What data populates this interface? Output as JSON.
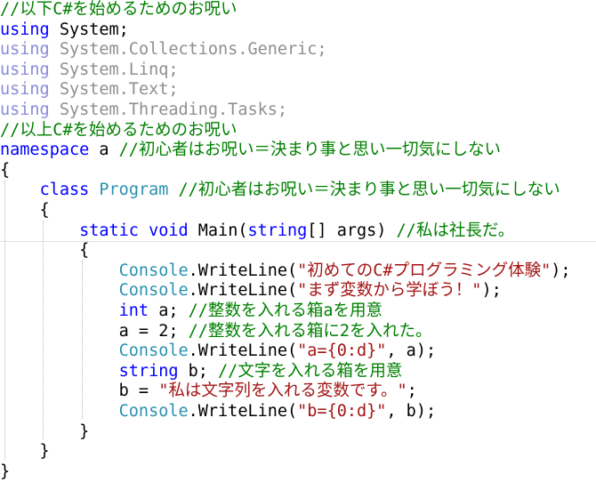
{
  "editor": {
    "lines": [
      {
        "tokens": [
          {
            "t": "//以下C#を始めるためのお呪い",
            "c": "cm"
          }
        ]
      },
      {
        "tokens": [
          {
            "t": "using",
            "c": "kw"
          },
          {
            "t": " System;",
            "c": "plain"
          }
        ]
      },
      {
        "tokens": [
          {
            "t": "using",
            "c": "kw-dim"
          },
          {
            "t": " System.Collections.Generic;",
            "c": "dim"
          }
        ]
      },
      {
        "tokens": [
          {
            "t": "using",
            "c": "kw-dim"
          },
          {
            "t": " System.Linq;",
            "c": "dim"
          }
        ]
      },
      {
        "tokens": [
          {
            "t": "using",
            "c": "kw-dim"
          },
          {
            "t": " System.Text;",
            "c": "dim"
          }
        ]
      },
      {
        "tokens": [
          {
            "t": "using",
            "c": "kw-dim"
          },
          {
            "t": " System.Threading.Tasks;",
            "c": "dim"
          }
        ]
      },
      {
        "tokens": [
          {
            "t": "//以上C#を始めるためのお呪い",
            "c": "cm"
          }
        ]
      },
      {
        "tokens": [
          {
            "t": "namespace",
            "c": "kw"
          },
          {
            "t": " a ",
            "c": "plain"
          },
          {
            "t": "//初心者はお呪い＝決まり事と思い一切気にしない",
            "c": "cm"
          }
        ]
      },
      {
        "tokens": [
          {
            "t": "{",
            "c": "plain"
          }
        ]
      },
      {
        "tokens": [
          {
            "t": "    ",
            "c": "plain"
          },
          {
            "t": "class",
            "c": "kw"
          },
          {
            "t": " ",
            "c": "plain"
          },
          {
            "t": "Program",
            "c": "type"
          },
          {
            "t": " ",
            "c": "plain"
          },
          {
            "t": "//初心者はお呪い＝決まり事と思い一切気にしない",
            "c": "cm"
          }
        ]
      },
      {
        "tokens": [
          {
            "t": "    {",
            "c": "plain"
          }
        ]
      },
      {
        "tokens": [
          {
            "t": "        ",
            "c": "plain"
          },
          {
            "t": "static",
            "c": "kw"
          },
          {
            "t": " ",
            "c": "plain"
          },
          {
            "t": "void",
            "c": "kw"
          },
          {
            "t": " Main(",
            "c": "plain"
          },
          {
            "t": "string",
            "c": "kw"
          },
          {
            "t": "[] args) ",
            "c": "plain"
          },
          {
            "t": "//私は社長だ。",
            "c": "cm"
          }
        ]
      },
      {
        "tokens": [
          {
            "t": "        {",
            "c": "plain"
          }
        ]
      },
      {
        "tokens": [
          {
            "t": "            ",
            "c": "plain"
          },
          {
            "t": "Console",
            "c": "type"
          },
          {
            "t": ".WriteLine(",
            "c": "plain"
          },
          {
            "t": "\"初めてのC#プログラミング体験\"",
            "c": "str"
          },
          {
            "t": ");",
            "c": "plain"
          }
        ]
      },
      {
        "tokens": [
          {
            "t": "            ",
            "c": "plain"
          },
          {
            "t": "Console",
            "c": "type"
          },
          {
            "t": ".WriteLine(",
            "c": "plain"
          },
          {
            "t": "\"まず変数から学ぼう！\"",
            "c": "str"
          },
          {
            "t": ");",
            "c": "plain"
          }
        ]
      },
      {
        "tokens": [
          {
            "t": "            ",
            "c": "plain"
          },
          {
            "t": "int",
            "c": "kw"
          },
          {
            "t": " a; ",
            "c": "plain"
          },
          {
            "t": "//整数を入れる箱aを用意",
            "c": "cm"
          }
        ]
      },
      {
        "tokens": [
          {
            "t": "            a = 2; ",
            "c": "plain"
          },
          {
            "t": "//整数を入れる箱に2を入れた。",
            "c": "cm"
          }
        ]
      },
      {
        "tokens": [
          {
            "t": "            ",
            "c": "plain"
          },
          {
            "t": "Console",
            "c": "type"
          },
          {
            "t": ".WriteLine(",
            "c": "plain"
          },
          {
            "t": "\"a={0:d}\"",
            "c": "str"
          },
          {
            "t": ", a);",
            "c": "plain"
          }
        ]
      },
      {
        "tokens": [
          {
            "t": "            ",
            "c": "plain"
          },
          {
            "t": "string",
            "c": "kw"
          },
          {
            "t": " b; ",
            "c": "plain"
          },
          {
            "t": "//文字を入れる箱を用意",
            "c": "cm"
          }
        ]
      },
      {
        "tokens": [
          {
            "t": "            b = ",
            "c": "plain"
          },
          {
            "t": "\"私は文字列を入れる変数です。\"",
            "c": "str"
          },
          {
            "t": ";",
            "c": "plain"
          }
        ]
      },
      {
        "tokens": [
          {
            "t": "            ",
            "c": "plain"
          },
          {
            "t": "Console",
            "c": "type"
          },
          {
            "t": ".WriteLine(",
            "c": "plain"
          },
          {
            "t": "\"b={0:d}\"",
            "c": "str"
          },
          {
            "t": ", b);",
            "c": "plain"
          }
        ]
      },
      {
        "tokens": [
          {
            "t": "        }",
            "c": "plain"
          }
        ]
      },
      {
        "tokens": [
          {
            "t": "    }",
            "c": "plain"
          }
        ]
      },
      {
        "tokens": [
          {
            "t": "}",
            "c": "plain"
          }
        ]
      }
    ],
    "colors": {
      "keyword": "#0000ff",
      "keyword_faded": "#8a8ad8",
      "faded_text": "#8f8f8f",
      "type": "#2b91af",
      "comment": "#008000",
      "string": "#a31515",
      "text": "#000000",
      "background": "#ffffff"
    }
  }
}
